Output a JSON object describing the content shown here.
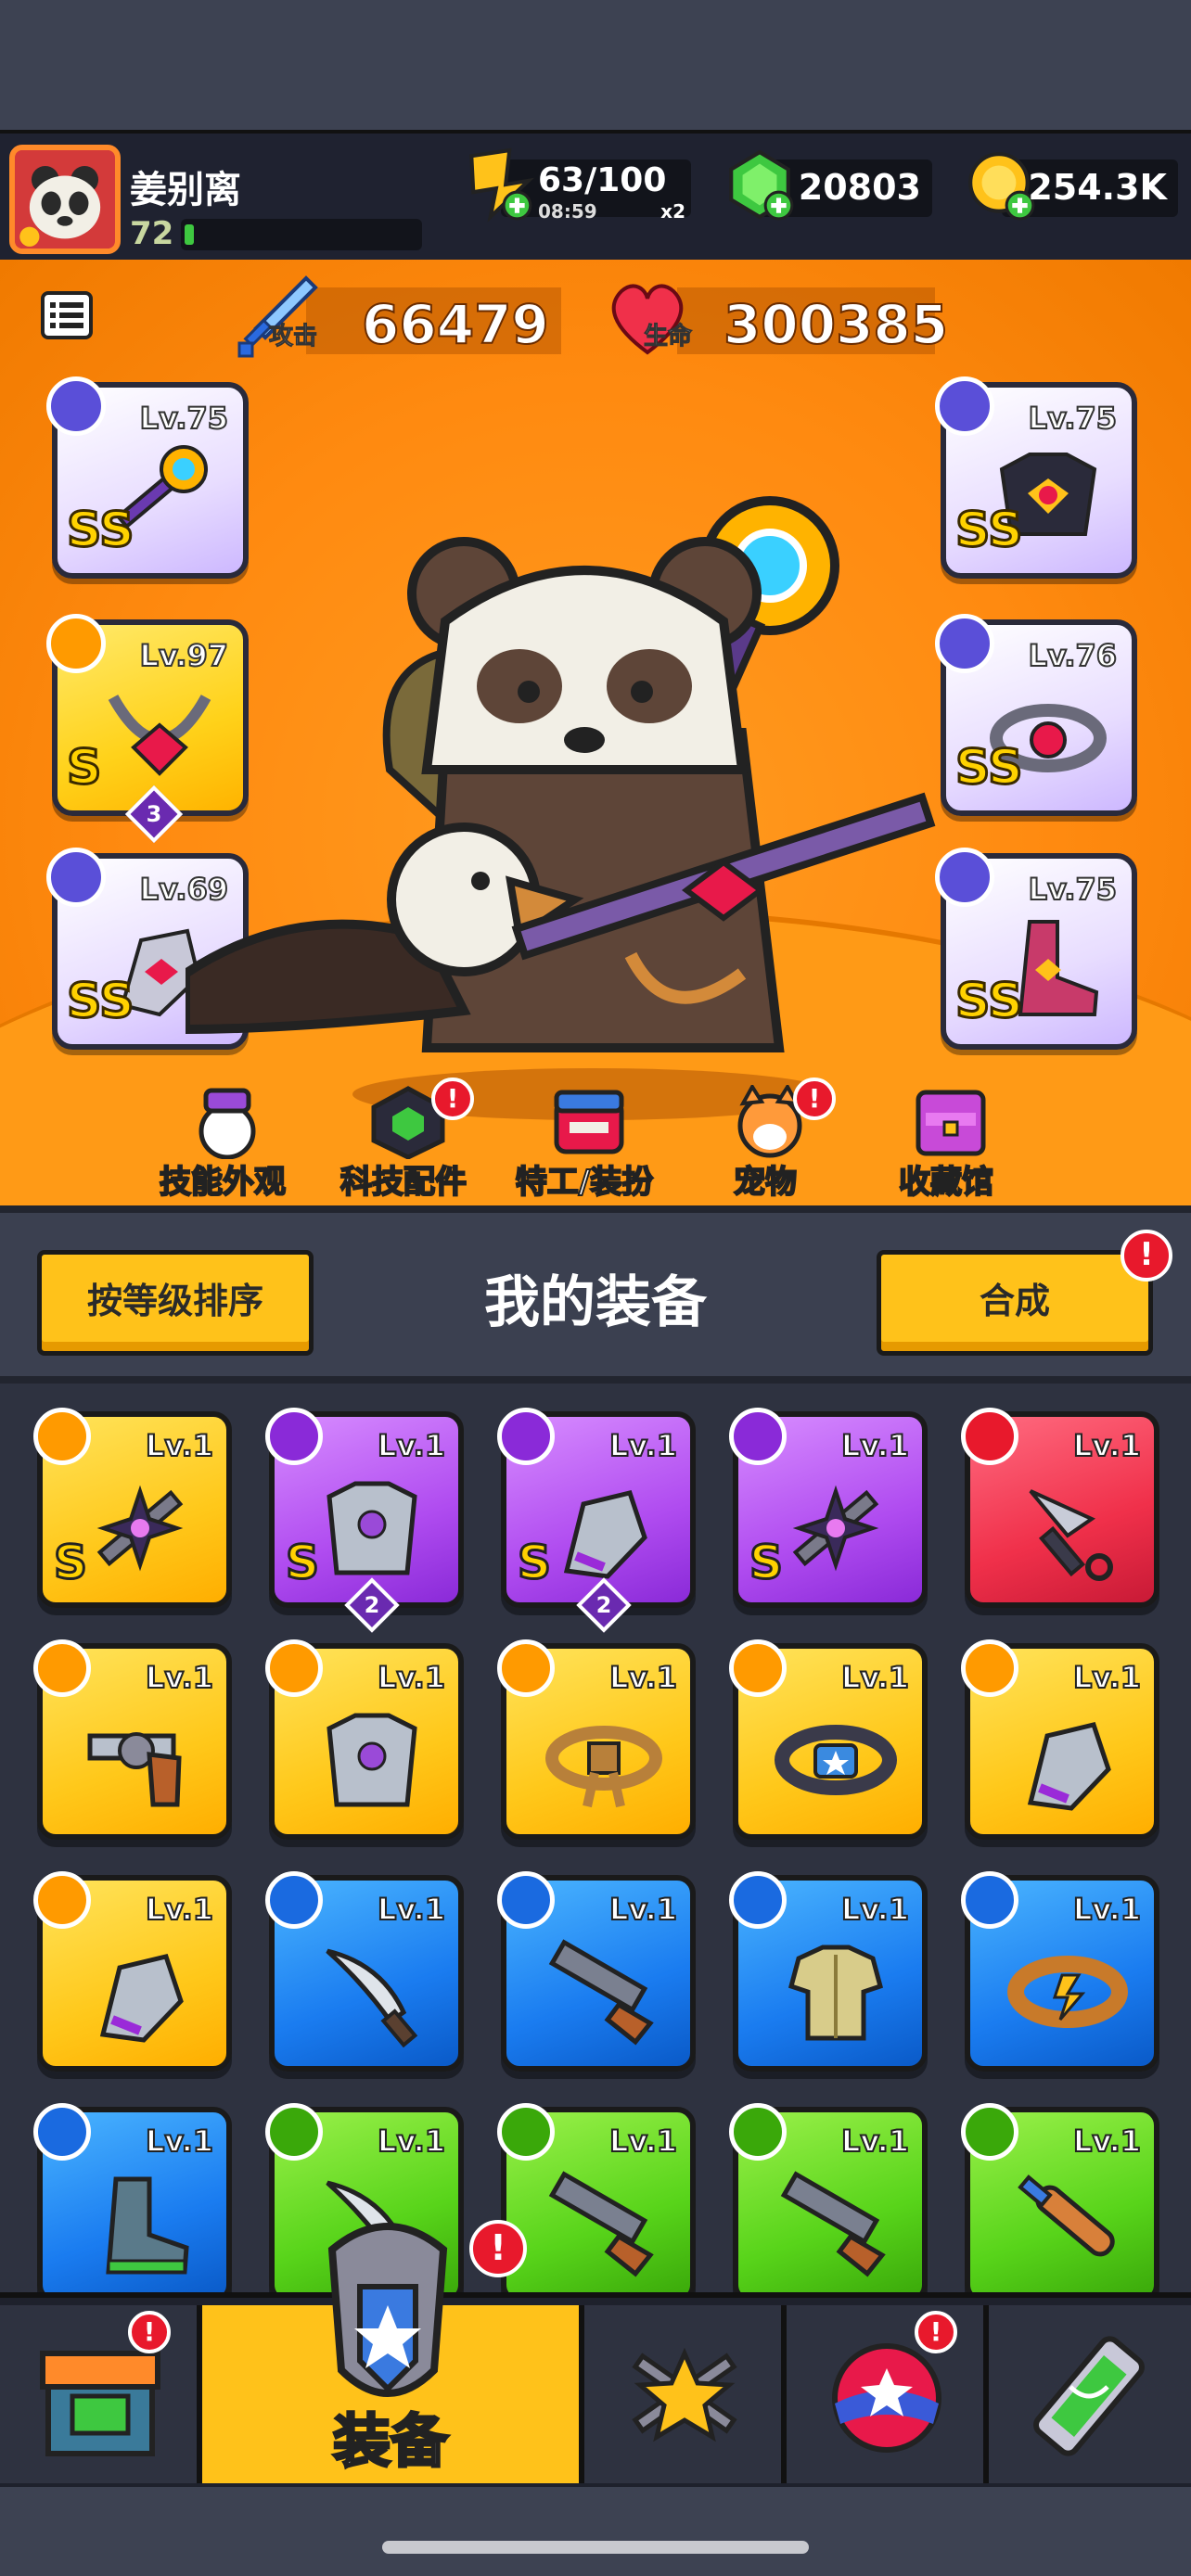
{
  "player": {
    "name": "姜别离",
    "level": "72",
    "xp_fraction": 0.04
  },
  "resources": {
    "energy": {
      "value": "63/100",
      "timer": "08:59",
      "multiplier": "x2"
    },
    "gems": "20803",
    "gold": "254.3K"
  },
  "stats": {
    "attack": {
      "label": "攻击",
      "value": "66479"
    },
    "health": {
      "label": "生命",
      "value": "300385"
    }
  },
  "equipped": {
    "left": [
      {
        "level": "Lv.75",
        "grade": "SS",
        "rarity": "epic",
        "type": "weapon"
      },
      {
        "level": "Lv.97",
        "grade": "S",
        "rarity": "gold",
        "type": "necklace",
        "stars": "3"
      },
      {
        "level": "Lv.69",
        "grade": "SS",
        "rarity": "epic",
        "type": "gloves"
      }
    ],
    "right": [
      {
        "level": "Lv.75",
        "grade": "SS",
        "rarity": "epic",
        "type": "armor"
      },
      {
        "level": "Lv.76",
        "grade": "SS",
        "rarity": "epic",
        "type": "belt"
      },
      {
        "level": "Lv.75",
        "grade": "SS",
        "rarity": "epic",
        "type": "boots"
      }
    ]
  },
  "shortcuts": [
    {
      "label": "技能外观",
      "icon": "skin-icon",
      "badge": ""
    },
    {
      "label": "科技配件",
      "icon": "tech-part-icon",
      "badge": "!"
    },
    {
      "label": "特工/装扮",
      "icon": "agent-icon",
      "badge": ""
    },
    {
      "label": "宠物",
      "icon": "pet-icon",
      "badge": "!"
    },
    {
      "label": "收藏馆",
      "icon": "collection-icon",
      "badge": ""
    }
  ],
  "equipment": {
    "title": "我的装备",
    "sort_label": "按等级排序",
    "merge_label": "合成",
    "merge_badge": "!",
    "items": [
      {
        "level": "Lv.1",
        "rarity": "gold",
        "grade": "S",
        "stars": "",
        "art": "shuriken-weapon"
      },
      {
        "level": "Lv.1",
        "rarity": "purple",
        "grade": "S",
        "stars": "2",
        "art": "armor"
      },
      {
        "level": "Lv.1",
        "rarity": "purple",
        "grade": "S",
        "stars": "2",
        "art": "gauntlet"
      },
      {
        "level": "Lv.1",
        "rarity": "purple",
        "grade": "S",
        "stars": "",
        "art": "shuriken-weapon"
      },
      {
        "level": "Lv.1",
        "rarity": "red",
        "grade": "",
        "stars": "",
        "art": "kunai"
      },
      {
        "level": "Lv.1",
        "rarity": "gold",
        "grade": "",
        "stars": "",
        "art": "revolver"
      },
      {
        "level": "Lv.1",
        "rarity": "gold",
        "grade": "",
        "stars": "",
        "art": "armor"
      },
      {
        "level": "Lv.1",
        "rarity": "gold",
        "grade": "",
        "stars": "",
        "art": "rope-belt"
      },
      {
        "level": "Lv.1",
        "rarity": "gold",
        "grade": "",
        "stars": "",
        "art": "badge-belt"
      },
      {
        "level": "Lv.1",
        "rarity": "gold",
        "grade": "",
        "stars": "",
        "art": "gauntlet"
      },
      {
        "level": "Lv.1",
        "rarity": "gold",
        "grade": "",
        "stars": "",
        "art": "gauntlet"
      },
      {
        "level": "Lv.1",
        "rarity": "blue",
        "grade": "",
        "stars": "",
        "art": "machete"
      },
      {
        "level": "Lv.1",
        "rarity": "blue",
        "grade": "",
        "stars": "",
        "art": "shotgun"
      },
      {
        "level": "Lv.1",
        "rarity": "blue",
        "grade": "",
        "stars": "",
        "art": "shirt"
      },
      {
        "level": "Lv.1",
        "rarity": "blue",
        "grade": "",
        "stars": "",
        "art": "belt"
      },
      {
        "level": "Lv.1",
        "rarity": "blue",
        "grade": "",
        "stars": "",
        "art": "boots"
      },
      {
        "level": "Lv.1",
        "rarity": "green",
        "grade": "",
        "stars": "",
        "art": "machete"
      },
      {
        "level": "Lv.1",
        "rarity": "green",
        "grade": "",
        "stars": "",
        "art": "shotgun"
      },
      {
        "level": "Lv.1",
        "rarity": "green",
        "grade": "",
        "stars": "",
        "art": "shotgun"
      },
      {
        "level": "Lv.1",
        "rarity": "green",
        "grade": "",
        "stars": "",
        "art": "bat"
      }
    ]
  },
  "nav": [
    {
      "label": "",
      "icon": "shop-icon",
      "badge": "!"
    },
    {
      "label": "装备",
      "icon": "equipment-icon",
      "badge": "!",
      "active": true
    },
    {
      "label": "",
      "icon": "battle-star-icon",
      "badge": ""
    },
    {
      "label": "",
      "icon": "stars-orb-icon",
      "badge": "!"
    },
    {
      "label": "",
      "icon": "dna-icon",
      "badge": ""
    }
  ],
  "colors": {
    "hero_orange": "#ff8a10",
    "accent_yellow": "#ffc21a",
    "badge_red": "#e8192c"
  }
}
